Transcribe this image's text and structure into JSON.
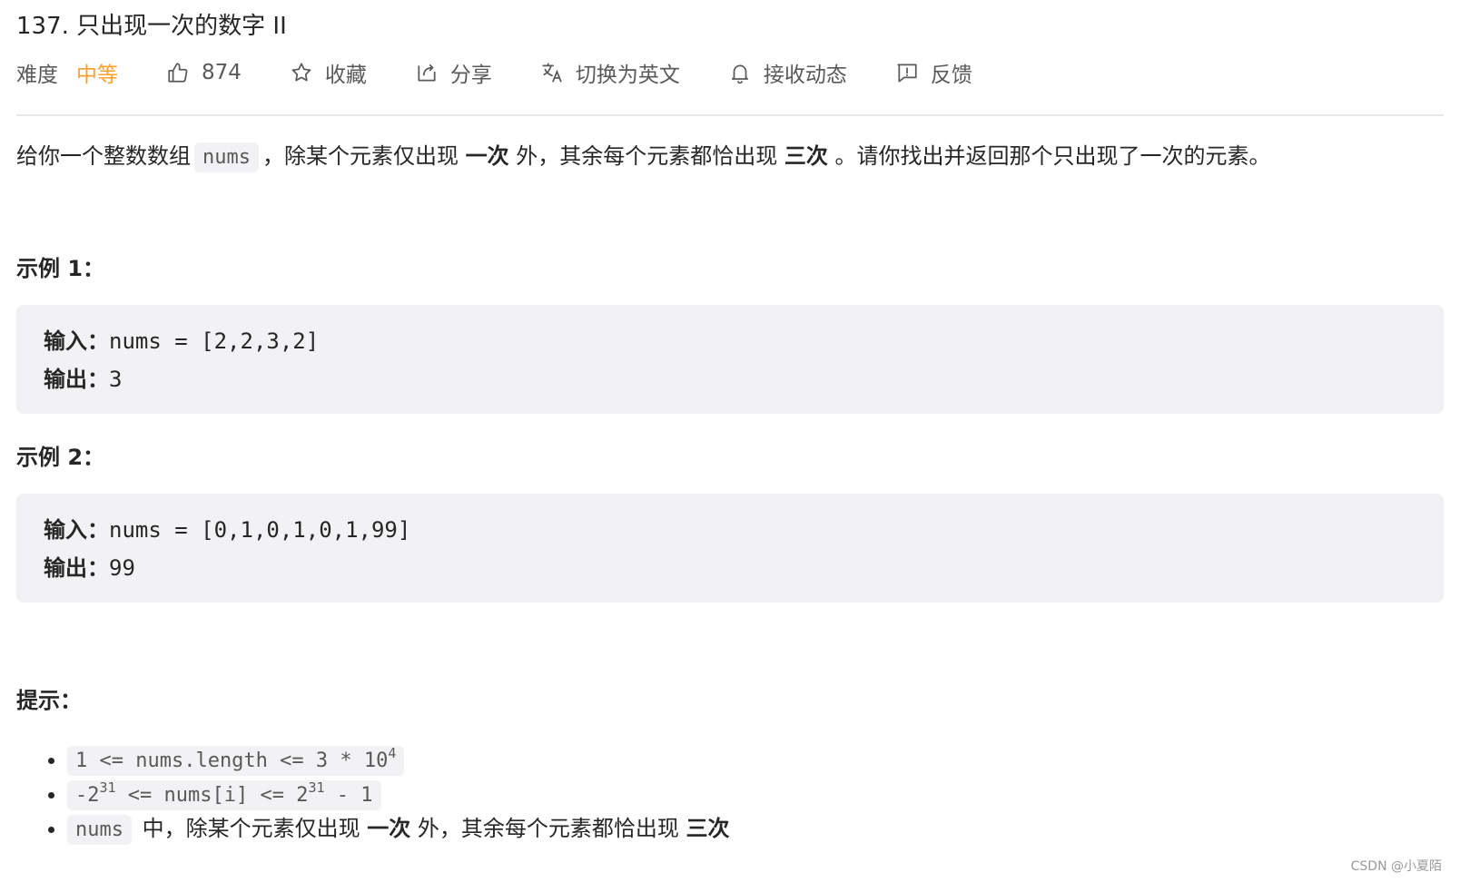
{
  "problem": {
    "title": "137. 只出现一次的数字 II"
  },
  "meta": {
    "difficulty_label": "难度",
    "difficulty_value": "中等",
    "difficulty_color": "#ff9f2e",
    "likes": "874",
    "favorite_label": "收藏",
    "share_label": "分享",
    "translate_label": "切换为英文",
    "subscribe_label": "接收动态",
    "feedback_label": "反馈",
    "icons": [
      "thumbs-up-icon",
      "star-icon",
      "share-icon",
      "translate-icon",
      "bell-icon",
      "feedback-icon"
    ]
  },
  "description": {
    "p1": "给你一个整数数组",
    "code1": "nums",
    "p2": "，除某个元素仅出现",
    "b1": "一次",
    "p3": "外，其余每个元素都恰出现",
    "b2": "三次",
    "p4": "。请你找出并返回那个只出现了一次的元素。"
  },
  "examples": [
    {
      "heading": "示例 1：",
      "input_label": "输入：",
      "input_value": "nums = [2,2,3,2]",
      "output_label": "输出：",
      "output_value": "3"
    },
    {
      "heading": "示例 2：",
      "input_label": "输入：",
      "input_value": "nums = [0,1,0,1,0,1,99]",
      "output_label": "输出：",
      "output_value": "99"
    }
  ],
  "hints": {
    "heading": "提示：",
    "h1_code": "1 <= nums.length <= 3 * 10",
    "h1_sup": "4",
    "h2_a": "-2",
    "h2_sup1": "31",
    "h2_b": " <= nums[i] <= 2",
    "h2_sup2": "31",
    "h2_c": " - 1",
    "h3_code": "nums",
    "h3_t1": " 中，除某个元素仅出现 ",
    "h3_b1": "一次",
    "h3_t2": " 外，其余每个元素都恰出现 ",
    "h3_b2": "三次"
  },
  "watermark": "CSDN @小夏陌"
}
